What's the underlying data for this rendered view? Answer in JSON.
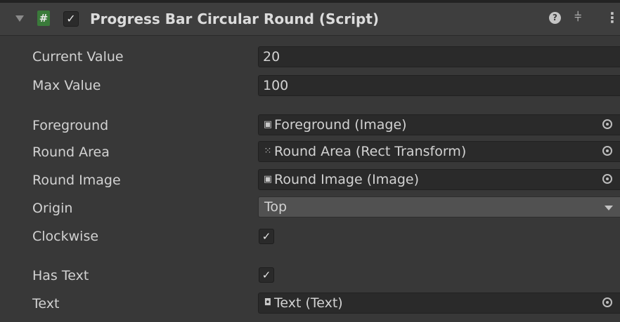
{
  "component": {
    "title": "Progress Bar Circular Round (Script)",
    "enabled": true,
    "icons": {
      "foldout": "foldout-arrow-icon",
      "script": "script-hash-icon",
      "help": "help-icon",
      "presets": "presets-icon",
      "menu": "kebab-menu-icon"
    }
  },
  "fields": {
    "current_value": {
      "label": "Current Value",
      "value": "20"
    },
    "max_value": {
      "label": "Max Value",
      "value": "100"
    },
    "foreground": {
      "label": "Foreground",
      "value": "Foreground (Image)",
      "icon": "image-icon"
    },
    "round_area": {
      "label": "Round Area",
      "value": "Round Area (Rect Transform)",
      "icon": "rect-transform-icon"
    },
    "round_image": {
      "label": "Round Image",
      "value": "Round Image (Image)",
      "icon": "image-icon"
    },
    "origin": {
      "label": "Origin",
      "value": "Top"
    },
    "clockwise": {
      "label": "Clockwise",
      "checked": true
    },
    "has_text": {
      "label": "Has Text",
      "checked": true
    },
    "text": {
      "label": "Text",
      "value": "Text (Text)",
      "icon": "text-icon"
    }
  },
  "colors": {
    "background": "#383838",
    "header": "#3e3e3e",
    "field": "#2a2a2a",
    "dropdown": "#515151",
    "script_icon": "#3a7a3a"
  }
}
